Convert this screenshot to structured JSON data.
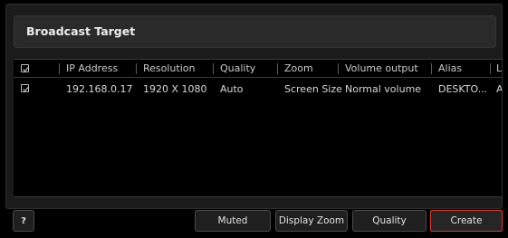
{
  "dialog": {
    "title": "Broadcast Target"
  },
  "table": {
    "columns": [
      "IP Address",
      "Resolution",
      "Quality",
      "Zoom",
      "Volume output",
      "Alias",
      "Lo"
    ],
    "rows": [
      {
        "checked": true,
        "ip_address": "192.168.0.17",
        "resolution": "1920 X 1080",
        "quality": "Auto",
        "zoom": "Screen Size",
        "volume_output": "Normal volume",
        "alias": "DESKTO...",
        "lo": "Ac"
      }
    ],
    "header_checked": true
  },
  "footer": {
    "help_label": "?",
    "muted_label": "Muted",
    "display_zoom_label": "Display Zoom",
    "quality_label": "Quality",
    "create_label": "Create"
  },
  "colors": {
    "background": "#000000",
    "panel": "#1b1b1b",
    "accent_border": "#e0392b"
  }
}
